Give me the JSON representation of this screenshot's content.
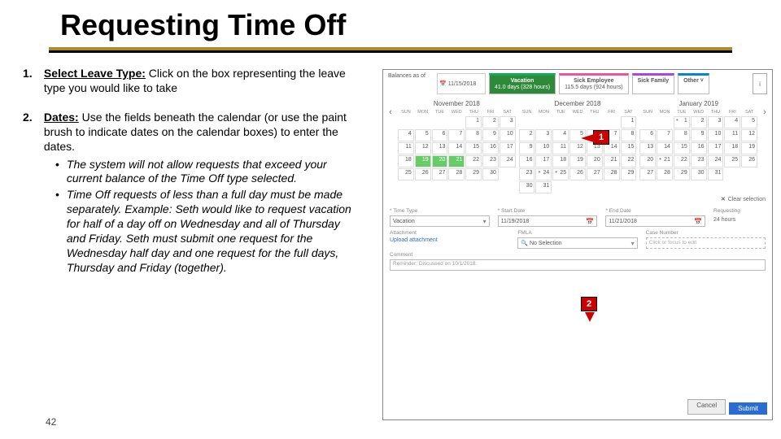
{
  "title": "Requesting Time Off",
  "page_number": "42",
  "steps": {
    "s1": {
      "num": "1.",
      "lead": "Select Leave Type:",
      "rest": " Click on the box representing the leave type you would like to take"
    },
    "s2": {
      "num": "2.",
      "lead": "Dates:",
      "rest": " Use the fields beneath the calendar (or use the paint brush to indicate dates on the calendar boxes) to enter the dates.",
      "b1": "The system will not allow requests that exceed your current balance of the Time Off type selected.",
      "b2": "Time Off requests of less than a full day must be made separately. Example: Seth would like to request vacation for half of a day off on Wednesday and all of Thursday and Friday. Seth must submit one request for the Wednesday half day and one request for the full days, Thursday and Friday (together)."
    }
  },
  "callouts": {
    "c1": "1",
    "c2": "2"
  },
  "shot": {
    "balances_label": "Balances as of",
    "balances_date": "11/15/2018",
    "tiles": {
      "vac": {
        "t": "Vacation",
        "d": "41.0 days (328 hours)"
      },
      "sick": {
        "t": "Sick Employee",
        "d": "115.5 days (924 hours)"
      },
      "sf": {
        "t": "Sick Family",
        "d": ""
      },
      "oth": {
        "t": "Other ˅",
        "d": ""
      }
    },
    "info": "i",
    "dow": [
      "SUN",
      "MON",
      "TUE",
      "WED",
      "THU",
      "FRI",
      "SAT"
    ],
    "months": {
      "m1": "November 2018",
      "m2": "December 2018",
      "m3": "January 2019"
    },
    "nav": {
      "prev": "‹",
      "next": "›"
    },
    "clear": "Clear selection",
    "form": {
      "time_type_l": "* Time Type",
      "time_type_v": "Vacation",
      "start_l": "* Start Date",
      "start_v": "11/19/2018",
      "end_l": "* End Date",
      "end_v": "11/21/2018",
      "req_l": "Requesting",
      "req_v": "24 hours",
      "att_l": "Attachment",
      "att_v": "Upload attachment",
      "fmla_l": "FMLA",
      "fmla_v": "No Selection",
      "case_l": "Case Number",
      "case_ph": "Click or focus to edit",
      "comment_l": "Comment",
      "comment_ph": "Reminder: Discussed on 10/1/2018."
    },
    "buttons": {
      "cancel": "Cancel",
      "submit": "Submit"
    }
  }
}
